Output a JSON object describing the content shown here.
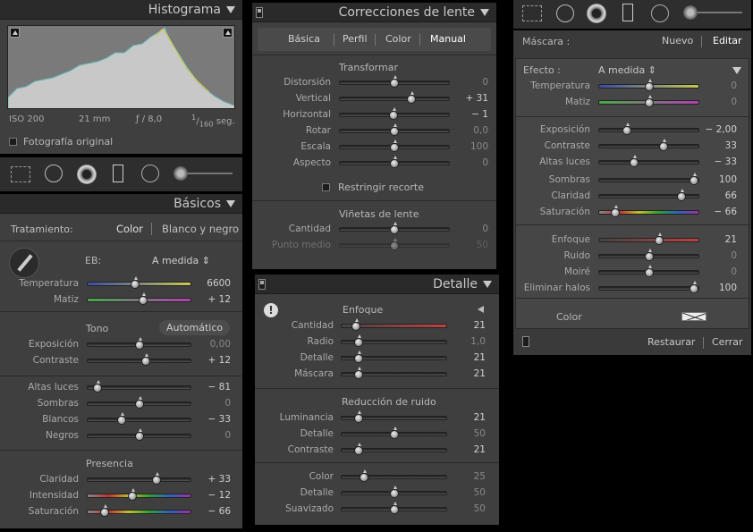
{
  "histogram": {
    "title": "Histograma",
    "iso": "ISO 200",
    "focal": "21 mm",
    "aperture": "ƒ / 8,0",
    "shutter_num": "1",
    "shutter_den": "160",
    "shutter_unit": "seg.",
    "original_label": "Fotografía original"
  },
  "basicos": {
    "title": "Básicos",
    "treatment_label": "Tratamiento:",
    "treatment_color": "Color",
    "treatment_bw": "Blanco y negro",
    "wb_label": "EB:",
    "wb_value": "A medida ⇕",
    "tone_label": "Tono",
    "auto_label": "Automático",
    "presence_label": "Presencia",
    "sliders": [
      {
        "label": "Temperatura",
        "value": "6600",
        "pos": 0.46,
        "track": "temp"
      },
      {
        "label": "Matiz",
        "value": "+ 12",
        "pos": 0.54,
        "track": "tint"
      },
      {
        "label": "Exposición",
        "value": "0,00",
        "pos": 0.5,
        "dim": true
      },
      {
        "label": "Contraste",
        "value": "+ 12",
        "pos": 0.56
      },
      {
        "label": "Altas luces",
        "value": "− 81",
        "pos": 0.1
      },
      {
        "label": "Sombras",
        "value": "0",
        "pos": 0.5,
        "dim": true
      },
      {
        "label": "Blancos",
        "value": "− 33",
        "pos": 0.33
      },
      {
        "label": "Negros",
        "value": "0",
        "pos": 0.5,
        "dim": true
      },
      {
        "label": "Claridad",
        "value": "+ 33",
        "pos": 0.67
      },
      {
        "label": "Intensidad",
        "value": "− 12",
        "pos": 0.44,
        "track": "sat"
      },
      {
        "label": "Saturación",
        "value": "− 66",
        "pos": 0.17,
        "track": "sat"
      }
    ]
  },
  "lens": {
    "title": "Correcciones de lente",
    "tabs": [
      "Básica",
      "Perfil",
      "Color",
      "Manual"
    ],
    "transform_label": "Transformar",
    "constrain_label": "Restringir recorte",
    "vignette_label": "Viñetas de lente",
    "sliders": [
      {
        "label": "Distorsión",
        "value": "0",
        "pos": 0.5,
        "dim": true
      },
      {
        "label": "Vertical",
        "value": "+ 31",
        "pos": 0.65
      },
      {
        "label": "Horizontal",
        "value": "− 1",
        "pos": 0.49
      },
      {
        "label": "Rotar",
        "value": "0,0",
        "pos": 0.5,
        "dim": true
      },
      {
        "label": "Escala",
        "value": "100",
        "pos": 0.5,
        "dim": true
      },
      {
        "label": "Aspecto",
        "value": "0",
        "pos": 0.5,
        "dim": true
      },
      {
        "label": "Cantidad",
        "value": "0",
        "pos": 0.5,
        "dim": true
      },
      {
        "label": "Punto medio",
        "value": "50",
        "pos": 0.5,
        "dim": true,
        "faded": true
      }
    ]
  },
  "detalle": {
    "title": "Detalle",
    "sharpen_label": "Enfoque",
    "noise_label": "Reducción de ruido",
    "sliders": [
      {
        "label": "Cantidad",
        "value": "21",
        "pos": 0.14,
        "track": "red"
      },
      {
        "label": "Radio",
        "value": "1,0",
        "pos": 0.17,
        "dim": true
      },
      {
        "label": "Detalle",
        "value": "21",
        "pos": 0.17
      },
      {
        "label": "Máscara",
        "value": "21",
        "pos": 0.17
      },
      {
        "label": "Luminancia",
        "value": "21",
        "pos": 0.17
      },
      {
        "label": "Detalle",
        "value": "50",
        "pos": 0.5,
        "dim": true
      },
      {
        "label": "Contraste",
        "value": "21",
        "pos": 0.17
      },
      {
        "label": "Color",
        "value": "25",
        "pos": 0.22,
        "dim": true
      },
      {
        "label": "Detalle",
        "value": "50",
        "pos": 0.5,
        "dim": true
      },
      {
        "label": "Suavizado",
        "value": "50",
        "pos": 0.5,
        "dim": true
      }
    ]
  },
  "mascara": {
    "label": "Máscara :",
    "new_label": "Nuevo",
    "edit_label": "Editar",
    "effect_label": "Efecto :",
    "effect_value": "A medida ⇕",
    "color_label": "Color",
    "reset_label": "Restaurar",
    "close_label": "Cerrar",
    "sliders": [
      {
        "label": "Temperatura",
        "value": "0",
        "pos": 0.5,
        "dim": true,
        "track": "temp"
      },
      {
        "label": "Matiz",
        "value": "0",
        "pos": 0.5,
        "dim": true,
        "track": "tint"
      },
      {
        "label": "Exposición",
        "value": "− 2,00",
        "pos": 0.28
      },
      {
        "label": "Contraste",
        "value": "33",
        "pos": 0.65
      },
      {
        "label": "Altas luces",
        "value": "− 33",
        "pos": 0.35
      },
      {
        "label": "Sombras",
        "value": "100",
        "pos": 0.95
      },
      {
        "label": "Claridad",
        "value": "66",
        "pos": 0.82
      },
      {
        "label": "Saturación",
        "value": "− 66",
        "pos": 0.17,
        "track": "sat"
      },
      {
        "label": "Enfoque",
        "value": "21",
        "pos": 0.6,
        "track": "red"
      },
      {
        "label": "Ruido",
        "value": "0",
        "pos": 0.5,
        "dim": true
      },
      {
        "label": "Moiré",
        "value": "0",
        "pos": 0.5,
        "dim": true
      },
      {
        "label": "Eliminar halos",
        "value": "100",
        "pos": 0.95
      }
    ]
  }
}
